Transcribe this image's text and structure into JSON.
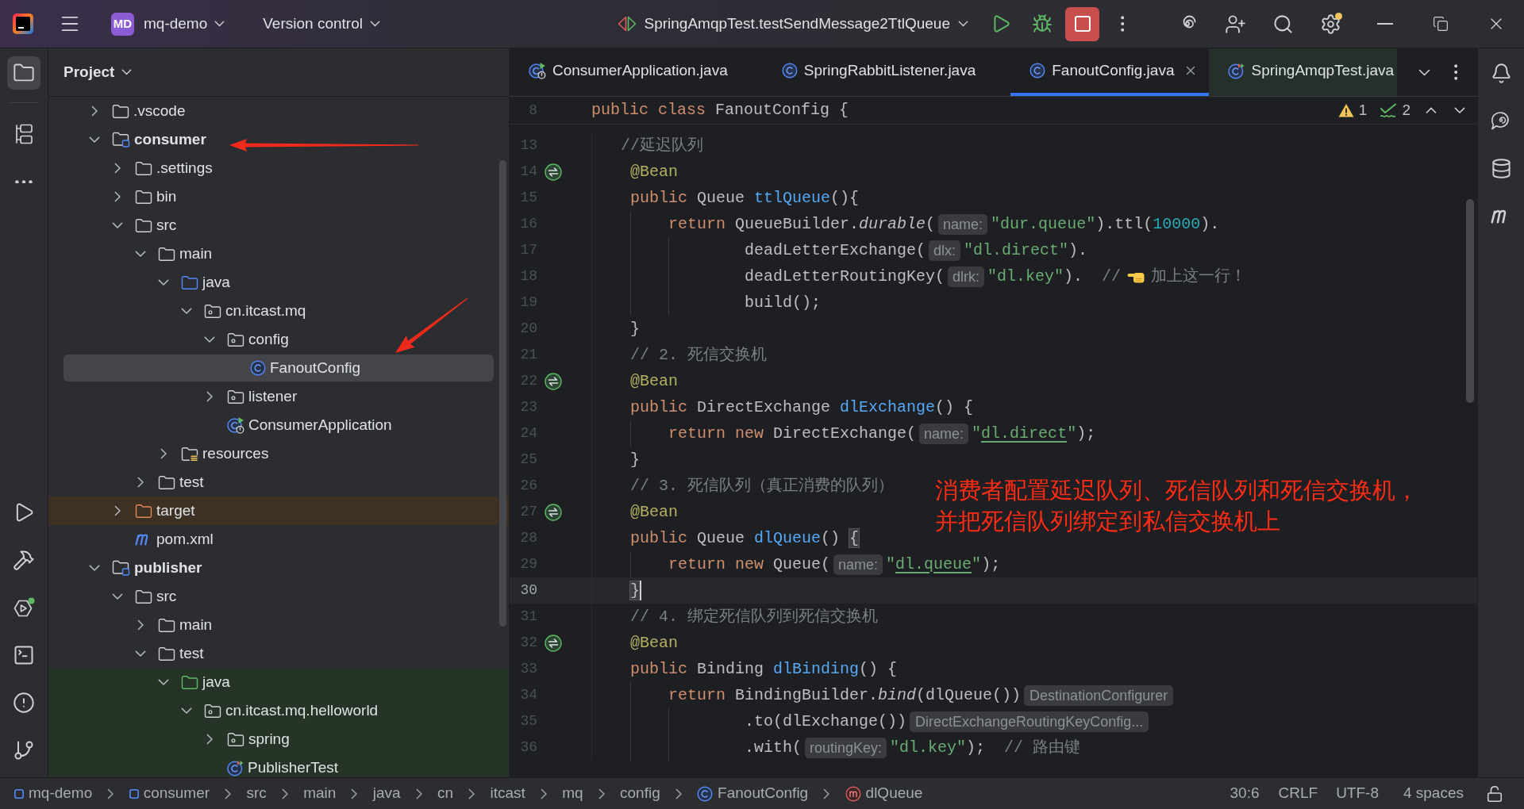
{
  "title_bar": {
    "project_badge": "MD",
    "project": "mq-demo",
    "vcs": "Version control",
    "run_config": "SpringAmqpTest.testSendMessage2TtlQueue"
  },
  "left_toolbar": {
    "top": [
      {
        "kind": "project",
        "selected": true
      },
      {
        "kind": "structure",
        "selected": false
      },
      {
        "kind": "more",
        "selected": false
      }
    ],
    "bottom": [
      {
        "kind": "run",
        "selected": false
      },
      {
        "kind": "build",
        "selected": false
      },
      {
        "kind": "services",
        "selected": false
      },
      {
        "kind": "terminal",
        "selected": false
      },
      {
        "kind": "problems",
        "selected": false
      },
      {
        "kind": "git",
        "selected": false
      }
    ]
  },
  "project_panel": {
    "title": "Project",
    "tree": [
      {
        "label": ".vscode",
        "kind": "folder",
        "expanded": false,
        "selected": false
      },
      {
        "label": "consumer",
        "kind": "module",
        "expanded": true,
        "selected": false,
        "children": [
          {
            "label": ".settings",
            "kind": "folder",
            "expanded": false,
            "selected": false
          },
          {
            "label": "bin",
            "kind": "folder",
            "expanded": false,
            "selected": false
          },
          {
            "label": "src",
            "kind": "folder",
            "expanded": true,
            "selected": false,
            "children": [
              {
                "label": "main",
                "kind": "folder",
                "expanded": true,
                "selected": false,
                "children": [
                  {
                    "label": "java",
                    "kind": "source_root",
                    "expanded": true,
                    "selected": false,
                    "children": [
                      {
                        "label": "cn.itcast.mq",
                        "kind": "package",
                        "expanded": true,
                        "selected": false,
                        "children": [
                          {
                            "label": "config",
                            "kind": "package",
                            "expanded": true,
                            "selected": false,
                            "children": [
                              {
                                "label": "FanoutConfig",
                                "kind": "class",
                                "selected": true
                              }
                            ]
                          },
                          {
                            "label": "listener",
                            "kind": "package",
                            "expanded": false,
                            "selected": false
                          },
                          {
                            "label": "ConsumerApplication",
                            "kind": "app_class",
                            "selected": false
                          }
                        ]
                      }
                    ]
                  },
                  {
                    "label": "resources",
                    "kind": "resources_root",
                    "expanded": false,
                    "selected": false
                  }
                ]
              },
              {
                "label": "test",
                "kind": "folder",
                "expanded": false,
                "selected": false
              }
            ]
          },
          {
            "label": "target",
            "kind": "excluded_folder",
            "expanded": false,
            "selected": false
          },
          {
            "label": "pom.xml",
            "kind": "maven_file",
            "selected": false
          }
        ]
      },
      {
        "label": "publisher",
        "kind": "module",
        "expanded": true,
        "selected": false,
        "children": [
          {
            "label": "src",
            "kind": "folder",
            "expanded": true,
            "selected": false,
            "children": [
              {
                "label": "main",
                "kind": "folder",
                "expanded": false,
                "selected": false
              },
              {
                "label": "test",
                "kind": "folder",
                "expanded": true,
                "selected": false,
                "children": [
                  {
                    "label": "java",
                    "kind": "test_root",
                    "expanded": true,
                    "selected": false,
                    "children": [
                      {
                        "label": "cn.itcast.mq.helloworld",
                        "kind": "package",
                        "expanded": true,
                        "selected": false,
                        "children": [
                          {
                            "label": "spring",
                            "kind": "package",
                            "expanded": false,
                            "selected": false
                          },
                          {
                            "label": "PublisherTest",
                            "kind": "test_class",
                            "selected": false
                          }
                        ]
                      }
                    ]
                  }
                ]
              }
            ]
          }
        ]
      }
    ]
  },
  "tabs": [
    {
      "label": "ConsumerApplication.java",
      "kind": "app_class",
      "selected": false
    },
    {
      "label": "SpringRabbitListener.java",
      "kind": "class",
      "selected": false
    },
    {
      "label": "FanoutConfig.java",
      "kind": "class",
      "selected": true
    },
    {
      "label": "SpringAmqpTest.java",
      "kind": "test_class",
      "selected": false
    }
  ],
  "editor": {
    "sticky": {
      "number": "8",
      "tokens": [
        {
          "text": "public class",
          "kind": "keyword"
        },
        {
          "text": " FanoutConfig {",
          "kind": "plain"
        }
      ]
    },
    "inspections": [
      {
        "kind": "warning",
        "count": "1"
      },
      {
        "kind": "typo",
        "count": "2"
      }
    ],
    "lines": [
      {
        "number": "13",
        "bean": false,
        "current": false,
        "tokens": [
          {
            "text": "   //延迟队列",
            "kind": "comment"
          }
        ]
      },
      {
        "number": "14",
        "bean": true,
        "current": false,
        "tokens": [
          {
            "text": "    @Bean",
            "kind": "annotation"
          }
        ]
      },
      {
        "number": "15",
        "bean": false,
        "current": false,
        "tokens": [
          {
            "text": "    public",
            "kind": "keyword"
          },
          {
            "text": " Queue ",
            "kind": "plain"
          },
          {
            "text": "ttlQueue",
            "kind": "method"
          },
          {
            "text": "(){",
            "kind": "plain"
          }
        ]
      },
      {
        "number": "16",
        "bean": false,
        "current": false,
        "tokens": [
          {
            "text": "        return",
            "kind": "keyword"
          },
          {
            "text": " QueueBuilder.",
            "kind": "plain"
          },
          {
            "text": "durable",
            "kind": "static_call"
          },
          {
            "text": "(",
            "kind": "plain"
          },
          {
            "text": "name:",
            "kind": "hint"
          },
          {
            "text": "\"dur.queue\"",
            "kind": "string"
          },
          {
            "text": ").ttl(",
            "kind": "plain"
          },
          {
            "text": "10000",
            "kind": "number"
          },
          {
            "text": ").",
            "kind": "plain"
          }
        ]
      },
      {
        "number": "17",
        "bean": false,
        "current": false,
        "tokens": [
          {
            "text": "                deadLetterExchange(",
            "kind": "plain"
          },
          {
            "text": "dlx:",
            "kind": "hint"
          },
          {
            "text": "\"dl.direct\"",
            "kind": "string"
          },
          {
            "text": ").",
            "kind": "plain"
          }
        ]
      },
      {
        "number": "18",
        "bean": false,
        "current": false,
        "tokens": [
          {
            "text": "                deadLetterRoutingKey(",
            "kind": "plain"
          },
          {
            "text": "dlrk:",
            "kind": "hint"
          },
          {
            "text": "\"dl.key\"",
            "kind": "string"
          },
          {
            "text": ").",
            "kind": "plain"
          },
          {
            "text": "  //",
            "kind": "comment"
          },
          {
            "kind": "emoji"
          },
          {
            "text": "加上这一行！",
            "kind": "comment"
          }
        ]
      },
      {
        "number": "19",
        "bean": false,
        "current": false,
        "tokens": [
          {
            "text": "                build();",
            "kind": "plain"
          }
        ]
      },
      {
        "number": "20",
        "bean": false,
        "current": false,
        "tokens": [
          {
            "text": "    }",
            "kind": "plain"
          }
        ]
      },
      {
        "number": "21",
        "bean": false,
        "current": false,
        "tokens": [
          {
            "text": "    // 2. 死信交换机",
            "kind": "comment"
          }
        ]
      },
      {
        "number": "22",
        "bean": true,
        "current": false,
        "tokens": [
          {
            "text": "    @Bean",
            "kind": "annotation"
          }
        ]
      },
      {
        "number": "23",
        "bean": false,
        "current": false,
        "tokens": [
          {
            "text": "    public",
            "kind": "keyword"
          },
          {
            "text": " DirectExchange ",
            "kind": "plain"
          },
          {
            "text": "dlExchange",
            "kind": "method"
          },
          {
            "text": "() {",
            "kind": "plain"
          }
        ]
      },
      {
        "number": "24",
        "bean": false,
        "current": false,
        "tokens": [
          {
            "text": "        return new",
            "kind": "keyword"
          },
          {
            "text": " DirectExchange(",
            "kind": "plain"
          },
          {
            "text": "name:",
            "kind": "hint"
          },
          {
            "text": "\"",
            "kind": "string"
          },
          {
            "text": "dl.direct",
            "kind": "string_link"
          },
          {
            "text": "\"",
            "kind": "string"
          },
          {
            "text": ");",
            "kind": "plain"
          }
        ]
      },
      {
        "number": "25",
        "bean": false,
        "current": false,
        "tokens": [
          {
            "text": "    }",
            "kind": "plain"
          }
        ]
      },
      {
        "number": "26",
        "bean": false,
        "current": false,
        "tokens": [
          {
            "text": "    // 3. 死信队列（真正消费的队列）",
            "kind": "comment"
          }
        ]
      },
      {
        "number": "27",
        "bean": true,
        "current": false,
        "tokens": [
          {
            "text": "    @Bean",
            "kind": "annotation"
          }
        ]
      },
      {
        "number": "28",
        "bean": false,
        "current": false,
        "tokens": [
          {
            "text": "    public",
            "kind": "keyword"
          },
          {
            "text": " Queue ",
            "kind": "plain"
          },
          {
            "text": "dlQueue",
            "kind": "method"
          },
          {
            "text": "() ",
            "kind": "plain"
          },
          {
            "text": "{",
            "kind": "brace_match"
          }
        ]
      },
      {
        "number": "29",
        "bean": false,
        "current": false,
        "tokens": [
          {
            "text": "        return new",
            "kind": "keyword"
          },
          {
            "text": " Queue(",
            "kind": "plain"
          },
          {
            "text": "name:",
            "kind": "hint"
          },
          {
            "text": "\"",
            "kind": "string"
          },
          {
            "text": "dl.queue",
            "kind": "string_link"
          },
          {
            "text": "\"",
            "kind": "string"
          },
          {
            "text": ");",
            "kind": "plain"
          }
        ]
      },
      {
        "number": "30",
        "bean": false,
        "current": true,
        "tokens": [
          {
            "text": "    }",
            "kind": "brace_match"
          }
        ]
      },
      {
        "number": "31",
        "bean": false,
        "current": false,
        "tokens": [
          {
            "text": "    // 4. 绑定死信队列到死信交换机",
            "kind": "comment"
          }
        ]
      },
      {
        "number": "32",
        "bean": true,
        "current": false,
        "tokens": [
          {
            "text": "    @Bean",
            "kind": "annotation"
          }
        ]
      },
      {
        "number": "33",
        "bean": false,
        "current": false,
        "tokens": [
          {
            "text": "    public",
            "kind": "keyword"
          },
          {
            "text": " Binding ",
            "kind": "plain"
          },
          {
            "text": "dlBinding",
            "kind": "method"
          },
          {
            "text": "() {",
            "kind": "plain"
          }
        ]
      },
      {
        "number": "34",
        "bean": false,
        "current": false,
        "tokens": [
          {
            "text": "        return",
            "kind": "keyword"
          },
          {
            "text": " BindingBuilder.",
            "kind": "plain"
          },
          {
            "text": "bind",
            "kind": "static_call"
          },
          {
            "text": "(dlQueue())",
            "kind": "plain"
          },
          {
            "text": "DestinationConfigurer",
            "kind": "type_hint"
          }
        ]
      },
      {
        "number": "35",
        "bean": false,
        "current": false,
        "tokens": [
          {
            "text": "                .to(dlExchange())",
            "kind": "plain"
          },
          {
            "text": "DirectExchangeRoutingKeyConfig...",
            "kind": "type_hint"
          }
        ]
      },
      {
        "number": "36",
        "bean": false,
        "current": false,
        "tokens": [
          {
            "text": "                .with(",
            "kind": "plain"
          },
          {
            "text": "routingKey:",
            "kind": "hint"
          },
          {
            "text": "\"dl.key\"",
            "kind": "string"
          },
          {
            "text": ");",
            "kind": "plain"
          },
          {
            "text": "  // 路由键",
            "kind": "comment"
          }
        ]
      }
    ]
  },
  "right_toolbar": [
    {
      "kind": "notifications"
    },
    {
      "kind": "ai_chat"
    },
    {
      "kind": "database"
    },
    {
      "kind": "maven"
    }
  ],
  "annotation": {
    "lines": [
      "消费者配置延迟队列、死信队列和死信交换机，",
      "并把死信队列绑定到私信交换机上"
    ]
  },
  "status_bar": {
    "breadcrumbs": [
      {
        "label": "mq-demo",
        "kind": "module"
      },
      {
        "label": "consumer",
        "kind": "module"
      },
      {
        "label": "src",
        "kind": "plain"
      },
      {
        "label": "main",
        "kind": "plain"
      },
      {
        "label": "java",
        "kind": "plain"
      },
      {
        "label": "cn",
        "kind": "plain"
      },
      {
        "label": "itcast",
        "kind": "plain"
      },
      {
        "label": "mq",
        "kind": "plain"
      },
      {
        "label": "config",
        "kind": "plain"
      },
      {
        "label": "FanoutConfig",
        "kind": "class"
      },
      {
        "label": "dlQueue",
        "kind": "method"
      }
    ],
    "position": "30:6",
    "line_ending": "CRLF",
    "encoding": "UTF-8",
    "indent": "4 spaces"
  }
}
